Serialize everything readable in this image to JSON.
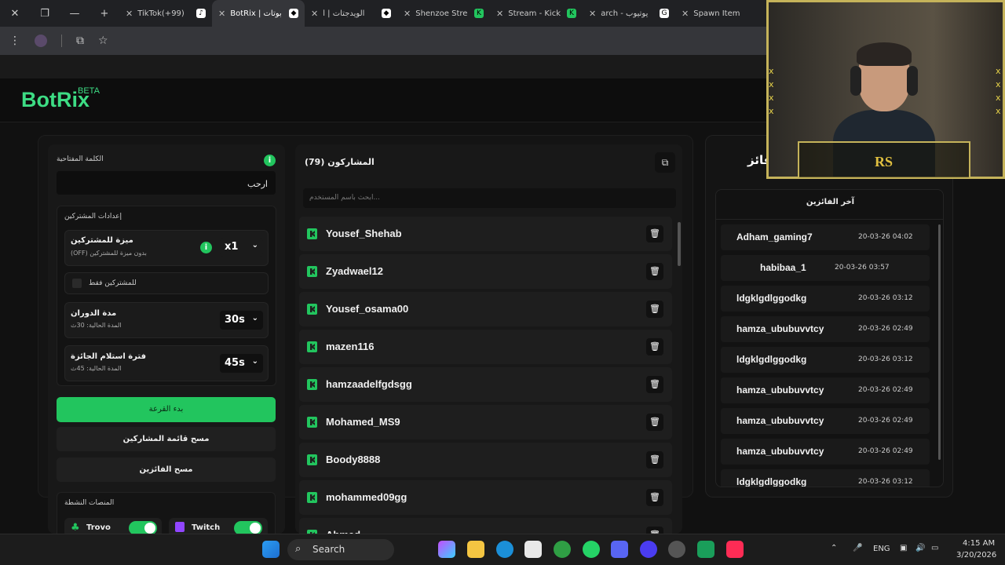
{
  "browser": {
    "tabs": [
      {
        "title": "TikTok(+99)",
        "icon": "tiktok-icon"
      },
      {
        "title": "BotRix | بوتات",
        "icon": "botrix-icon",
        "active": true
      },
      {
        "title": "الويدجتات | أ",
        "icon": "botrix-icon"
      },
      {
        "title": "Shenzoe Stre",
        "icon": "kick-icon"
      },
      {
        "title": "Stream - Kick",
        "icon": "kick-icon"
      },
      {
        "title": "arch - يوتيوب",
        "icon": "google-icon"
      },
      {
        "title": "Spawn Item",
        "icon": "web-icon"
      }
    ]
  },
  "app": {
    "logo": "BotRix",
    "badge": "BETA"
  },
  "settings": {
    "keyword_label": "الكلمة المفتاحية",
    "keyword_value": "ارحب",
    "subscriber_section": "إعدادات المشتركين",
    "sub_feature_title": "ميزة للمشتركين",
    "sub_feature_sub": "بدون ميزة للمشتركين (OFF)",
    "sub_multiplier": "x1",
    "subs_only_label": "للمشتركين فقط",
    "spin_title": "مدة الدوران",
    "spin_sub": "المدة الحالية: 30ث",
    "spin_value": "30s",
    "claim_title": "فترة استلام الجائزة",
    "claim_sub": "المدة الحالية: 45ث",
    "claim_value": "45s",
    "start_button": "بدء القرعة",
    "clear_participants_button": "مسح قائمة المشاركين",
    "clear_winners_button": "مسح الفائزين",
    "platforms_label": "المنصات النشطة",
    "platforms": [
      {
        "name": "Trovo",
        "enabled": true
      },
      {
        "name": "Twitch",
        "enabled": true
      }
    ]
  },
  "participants": {
    "title": "المشاركون (79)",
    "search_placeholder": "...ابحث باسم المستخدم",
    "list": [
      "Yousef_Shehab",
      "Zyadwael12",
      "Yousef_osama00",
      "mazen116",
      "hamzaadelfgdsgg",
      "Mohamed_MS9",
      "Boody8888",
      "mohammed09gg",
      "Ahmed...."
    ]
  },
  "winners": {
    "panel_title": "فائز",
    "list_title": "آخر الفائزين",
    "list": [
      {
        "name": "Adham_gaming7",
        "time": "20-03-26 04:02"
      },
      {
        "name": "habibaa_1",
        "time": "20-03-26 03:57"
      },
      {
        "name": "ldgklgdlggodkg",
        "time": "20-03-26 03:12"
      },
      {
        "name": "hamza_ububuvvtcy",
        "time": "20-03-26 02:49"
      },
      {
        "name": "ldgklgdlggodkg",
        "time": "20-03-26 03:12"
      },
      {
        "name": "hamza_ububuvvtcy",
        "time": "20-03-26 02:49"
      },
      {
        "name": "hamza_ububuvvtcy",
        "time": "20-03-26 02:49"
      },
      {
        "name": "hamza_ububuvvtcy",
        "time": "20-03-26 02:49"
      },
      {
        "name": "ldgklgdlggodkg",
        "time": "20-03-26 03:12"
      }
    ]
  },
  "webcam": {
    "overlay_logo": "RS"
  },
  "taskbar": {
    "search": "Search",
    "lang": "ENG",
    "time": "4:15 AM",
    "date": "3/20/2026"
  },
  "colors": {
    "accent": "#22c55e",
    "logo": "#3ddc84",
    "bg": "#111111"
  }
}
